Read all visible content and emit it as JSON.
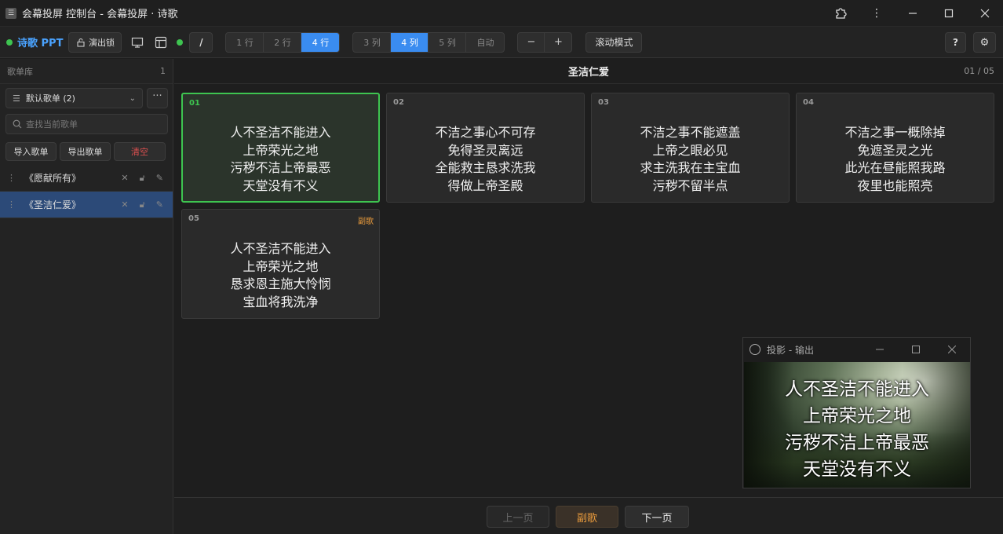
{
  "window": {
    "title": "会幕投屏 控制台 - 会幕投屏 · 诗歌"
  },
  "toolbar": {
    "brand": "诗歌 PPT",
    "lock_label": "演出锁",
    "slash_label": "/",
    "rows": [
      "1 行",
      "2 行",
      "4 行"
    ],
    "rows_active": 2,
    "cols": [
      "3 列",
      "4 列",
      "5 列",
      "自动"
    ],
    "cols_active": 1,
    "minus": "−",
    "plus": "+",
    "scroll_mode": "滚动模式",
    "help": "?",
    "status_color": "#3ec450",
    "accent_color": "#3a8cf0"
  },
  "sidebar": {
    "title": "歌单库",
    "count": "1",
    "playlist_select": "默认歌单 (2)",
    "more": "···",
    "search_placeholder": "查找当前歌单",
    "import_label": "导入歌单",
    "export_label": "导出歌单",
    "clear_label": "清空",
    "songs": [
      {
        "name": "《愿献所有》",
        "active": false
      },
      {
        "name": "《圣洁仁爱》",
        "active": true
      }
    ]
  },
  "main": {
    "song_title": "圣洁仁爱",
    "page_indicator": "01 / 05",
    "slides": [
      {
        "num": "01",
        "tag": "",
        "lines": "人不圣洁不能进入\n上帝荣光之地\n污秽不洁上帝最恶\n天堂没有不义",
        "current": true
      },
      {
        "num": "02",
        "tag": "",
        "lines": "不洁之事心不可存\n免得圣灵离远\n全能救主恳求洗我\n得做上帝圣殿",
        "current": false
      },
      {
        "num": "03",
        "tag": "",
        "lines": "不洁之事不能遮盖\n上帝之眼必见\n求主洗我在主宝血\n污秽不留半点",
        "current": false
      },
      {
        "num": "04",
        "tag": "",
        "lines": "不洁之事一概除掉\n免遮圣灵之光\n此光在昼能照我路\n夜里也能照亮",
        "current": false
      },
      {
        "num": "05",
        "tag": "副歌",
        "lines": "人不圣洁不能进入\n上帝荣光之地\n恳求恩主施大怜悯\n宝血将我洗净",
        "current": false
      }
    ]
  },
  "output_window": {
    "title": "投影 - 输出",
    "text": "人不圣洁不能进入\n上帝荣光之地\n污秽不洁上帝最恶\n天堂没有不义"
  },
  "bottom": {
    "prev_label": "上一页",
    "chorus_label": "副歌",
    "next_label": "下一页"
  }
}
